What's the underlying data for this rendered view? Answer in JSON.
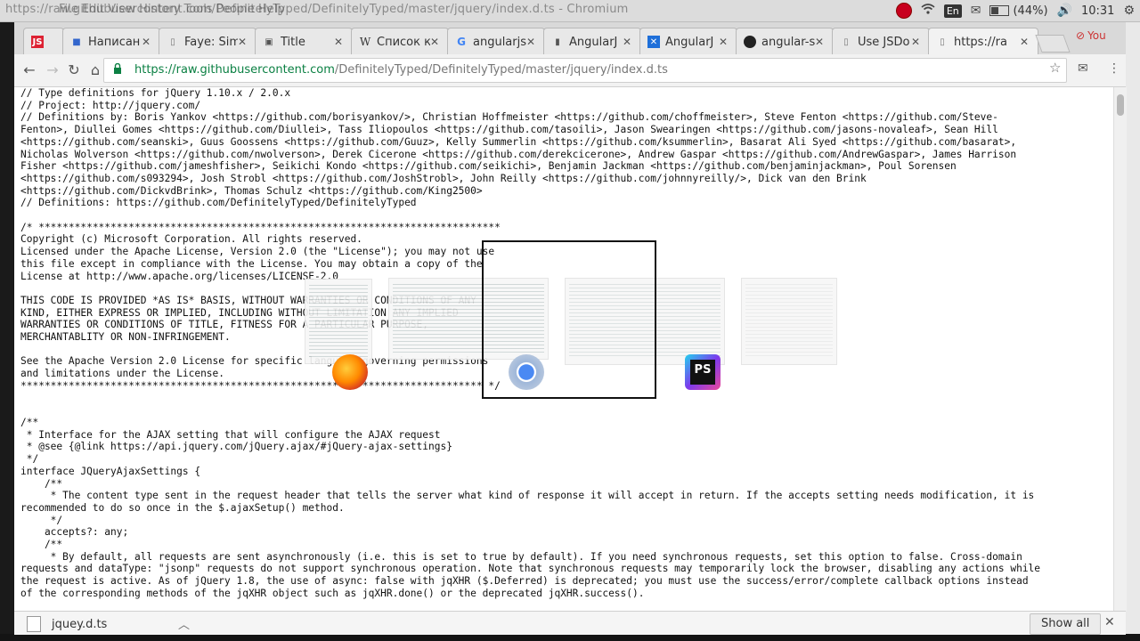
{
  "system": {
    "window_title": "https://raw.githubusercontent.com/DefinitelyTyped/DefinitelyTyped/master/jquery/index.d.ts - Chromium",
    "menus": "File  Edit  View  History  Tools  People  Help",
    "lang": "En",
    "battery": "(44%)",
    "time": "10:31"
  },
  "tabs": [
    {
      "label": "JS",
      "icon": "js-icon"
    },
    {
      "label": "Написан",
      "icon": "bookmark-icon"
    },
    {
      "label": "Faye: Sim",
      "icon": "page-icon"
    },
    {
      "label": "Title",
      "icon": "image-icon"
    },
    {
      "label": "Список к",
      "icon": "wikipedia-icon"
    },
    {
      "label": "angularjs",
      "icon": "google-icon"
    },
    {
      "label": "AngularJ",
      "icon": "android-icon"
    },
    {
      "label": "AngularJ",
      "icon": "bookmark-icon"
    },
    {
      "label": "angular-s",
      "icon": "github-icon"
    },
    {
      "label": "Use JSDo",
      "icon": "page-icon"
    },
    {
      "label": "https://ra",
      "icon": "page-icon"
    }
  ],
  "you_badge": "You",
  "address": {
    "scheme_host": "https://raw.githubusercontent.com",
    "path": "/DefinitelyTyped/DefinitelyTyped/master/jquery/index.d.ts"
  },
  "code_lines": [
    "// Type definitions for jQuery 1.10.x / 2.0.x",
    "// Project: http://jquery.com/",
    "// Definitions by: Boris Yankov <https://github.com/borisyankov/>, Christian Hoffmeister <https://github.com/choffmeister>, Steve Fenton <https://github.com/Steve-",
    "Fenton>, Diullei Gomes <https://github.com/Diullei>, Tass Iliopoulos <https://github.com/tasoili>, Jason Swearingen <https://github.com/jasons-novaleaf>, Sean Hill",
    "<https://github.com/seanski>, Guus Goossens <https://github.com/Guuz>, Kelly Summerlin <https://github.com/ksummerlin>, Basarat Ali Syed <https://github.com/basarat>,",
    "Nicholas Wolverson <https://github.com/nwolverson>, Derek Cicerone <https://github.com/derekcicerone>, Andrew Gaspar <https://github.com/AndrewGaspar>, James Harrison",
    "Fisher <https://github.com/jameshfisher>, Seikichi Kondo <https://github.com/seikichi>, Benjamin Jackman <https://github.com/benjaminjackman>, Poul Sorensen",
    "<https://github.com/s093294>, Josh Strobl <https://github.com/JoshStrobl>, John Reilly <https://github.com/johnnyreilly/>, Dick van den Brink",
    "<https://github.com/DickvdBrink>, Thomas Schulz <https://github.com/King2500>",
    "// Definitions: https://github.com/DefinitelyTyped/DefinitelyTyped",
    "",
    "/* *****************************************************************************",
    "Copyright (c) Microsoft Corporation. All rights reserved.",
    "Licensed under the Apache License, Version 2.0 (the \"License\"); you may not use",
    "this file except in compliance with the License. You may obtain a copy of the",
    "License at http://www.apache.org/licenses/LICENSE-2.0",
    "",
    "THIS CODE IS PROVIDED *AS IS* BASIS, WITHOUT WARRANTIES OR CONDITIONS OF ANY",
    "KIND, EITHER EXPRESS OR IMPLIED, INCLUDING WITHOUT LIMITATION ANY IMPLIED",
    "WARRANTIES OR CONDITIONS OF TITLE, FITNESS FOR A PARTICULAR PURPOSE,",
    "MERCHANTABLITY OR NON-INFRINGEMENT.",
    "",
    "See the Apache Version 2.0 License for specific language governing permissions",
    "and limitations under the License.",
    "***************************************************************************** */",
    "",
    "",
    "/**",
    " * Interface for the AJAX setting that will configure the AJAX request",
    " * @see {@link https://api.jquery.com/jQuery.ajax/#jQuery-ajax-settings}",
    " */",
    "interface JQueryAjaxSettings {",
    "    /**",
    "     * The content type sent in the request header that tells the server what kind of response it will accept in return. If the accepts setting needs modification, it is",
    "recommended to do so once in the $.ajaxSetup() method.",
    "     */",
    "    accepts?: any;",
    "    /**",
    "     * By default, all requests are sent asynchronously (i.e. this is set to true by default). If you need synchronous requests, set this option to false. Cross-domain",
    "requests and dataType: \"jsonp\" requests do not support synchronous operation. Note that synchronous requests may temporarily lock the browser, disabling any actions while",
    "the request is active. As of jQuery 1.8, the use of async: false with jqXHR ($.Deferred) is deprecated; you must use the success/error/complete callback options instead",
    "of the corresponding methods of the jqXHR object such as jqXHR.done() or the deprecated jqXHR.success()."
  ],
  "download": {
    "filename": "jquey.d.ts",
    "show_all": "Show all"
  },
  "switcher": {
    "apps": [
      "firefox-icon",
      "chromium-icon",
      "phpstorm-icon"
    ],
    "phpstorm_label": "PS"
  }
}
